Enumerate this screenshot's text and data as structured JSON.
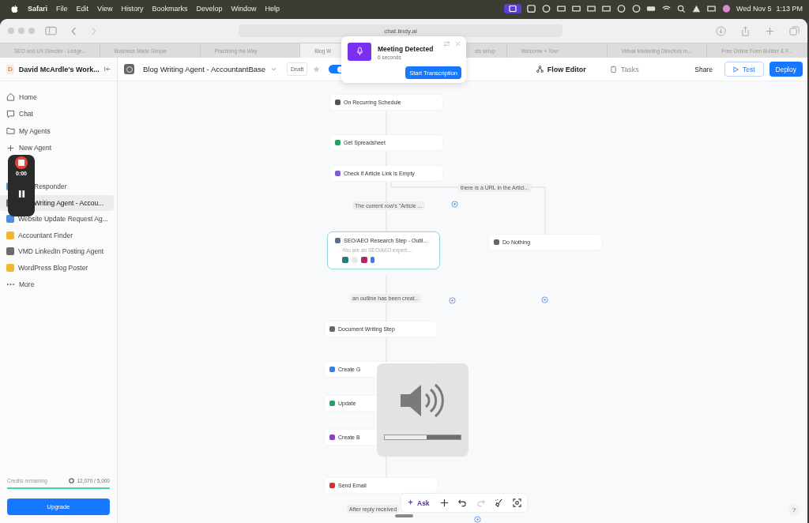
{
  "menu_bar": {
    "app": "Safari",
    "items": [
      "File",
      "Edit",
      "View",
      "History",
      "Bookmarks",
      "Develop",
      "Window",
      "Help"
    ],
    "date": "Wed Nov 5",
    "time": "1:13 PM"
  },
  "browser": {
    "url": "chat.lindy.ai",
    "tabs": [
      {
        "title": "SEO and UX Director - Ledge...",
        "selected": false
      },
      {
        "title": "Business Made Simple",
        "selected": false
      },
      {
        "title": "Practicing the Way",
        "selected": false
      },
      {
        "title": "Blog W",
        "selected": true
      },
      {
        "title": "sis setup",
        "selected": false
      },
      {
        "title": "Welcome + Tour",
        "selected": false
      },
      {
        "title": "Virtual Marketing Directors m...",
        "selected": false
      },
      {
        "title": "Free Online Form Builder & F...",
        "selected": false
      }
    ]
  },
  "meeting_popup": {
    "title": "Meeting Detected",
    "subtitle": "6 seconds",
    "button": "Start Transcription"
  },
  "sidebar": {
    "workspace_initial": "D",
    "workspace": "David McArdle's Work...",
    "nav": [
      {
        "kind": "home",
        "label": "Home"
      },
      {
        "kind": "chat",
        "label": "Chat"
      },
      {
        "kind": "folder",
        "label": "My Agents"
      },
      {
        "kind": "plus",
        "label": "New Agent"
      }
    ],
    "agents": [
      {
        "label": "Responder",
        "color": "#4a90e2",
        "selected": false
      },
      {
        "label": "Writing Agent - Accou...",
        "color": "#6b6b6b",
        "selected": true
      },
      {
        "label": "Website Update Request Ag...",
        "color": "#4a90e2",
        "selected": false
      },
      {
        "label": "Accountant Finder",
        "color": "#f2b630",
        "selected": false
      },
      {
        "label": "VMD LinkedIn Posting Agent",
        "color": "#6b6b6b",
        "selected": false
      },
      {
        "label": "WordPress Blog Poster",
        "color": "#f2b630",
        "selected": false
      }
    ],
    "more": "More",
    "credits": {
      "label": "Credits remaining",
      "value": "12,070 / 5,000",
      "level": 1
    },
    "upgrade": "Upgrade"
  },
  "recorder": {
    "time": "0:00"
  },
  "header": {
    "title": "Blog Writing Agent - AccountantBase",
    "status": "Draft",
    "enabled": true,
    "tabs": [
      {
        "kind": "flow",
        "label": "Flow Editor",
        "selected": true
      },
      {
        "kind": "tasks",
        "label": "Tasks",
        "selected": false
      }
    ],
    "share": "Share",
    "test": "Test",
    "deploy": "Deploy"
  },
  "flow": {
    "nodes": [
      {
        "kind": "schedule",
        "label": "On Recurring Schedule"
      },
      {
        "kind": "sheet",
        "label": "Get Spreadsheet"
      },
      {
        "kind": "branch",
        "label": "Check if Article Link is Empty"
      },
      {
        "kind": "agent",
        "label": "SEO/AEO Research Step - Outli...",
        "description": "You are an SEO/AEO expert...."
      },
      {
        "kind": "noop",
        "label": "Do Nothing"
      },
      {
        "kind": "noop",
        "label": "Document Writing Step"
      },
      {
        "kind": "doc",
        "label": "Create G"
      },
      {
        "kind": "sheet",
        "label": "Update"
      },
      {
        "kind": "app",
        "label": "Create B"
      },
      {
        "kind": "email",
        "label": "Send Email"
      }
    ],
    "edge_labels": [
      "there is a URL in the Articl...",
      "The current row's \"Article ...",
      "an outline has been creat...",
      "After reply received"
    ]
  },
  "volume": {
    "level": 0.55
  },
  "toolbar": {
    "ask": "Ask",
    "tools": [
      {
        "kind": "add",
        "disabled": false
      },
      {
        "kind": "undo",
        "disabled": false
      },
      {
        "kind": "redo",
        "disabled": true
      },
      {
        "kind": "clean",
        "disabled": false
      },
      {
        "kind": "focus",
        "disabled": false
      }
    ]
  },
  "help": "?"
}
